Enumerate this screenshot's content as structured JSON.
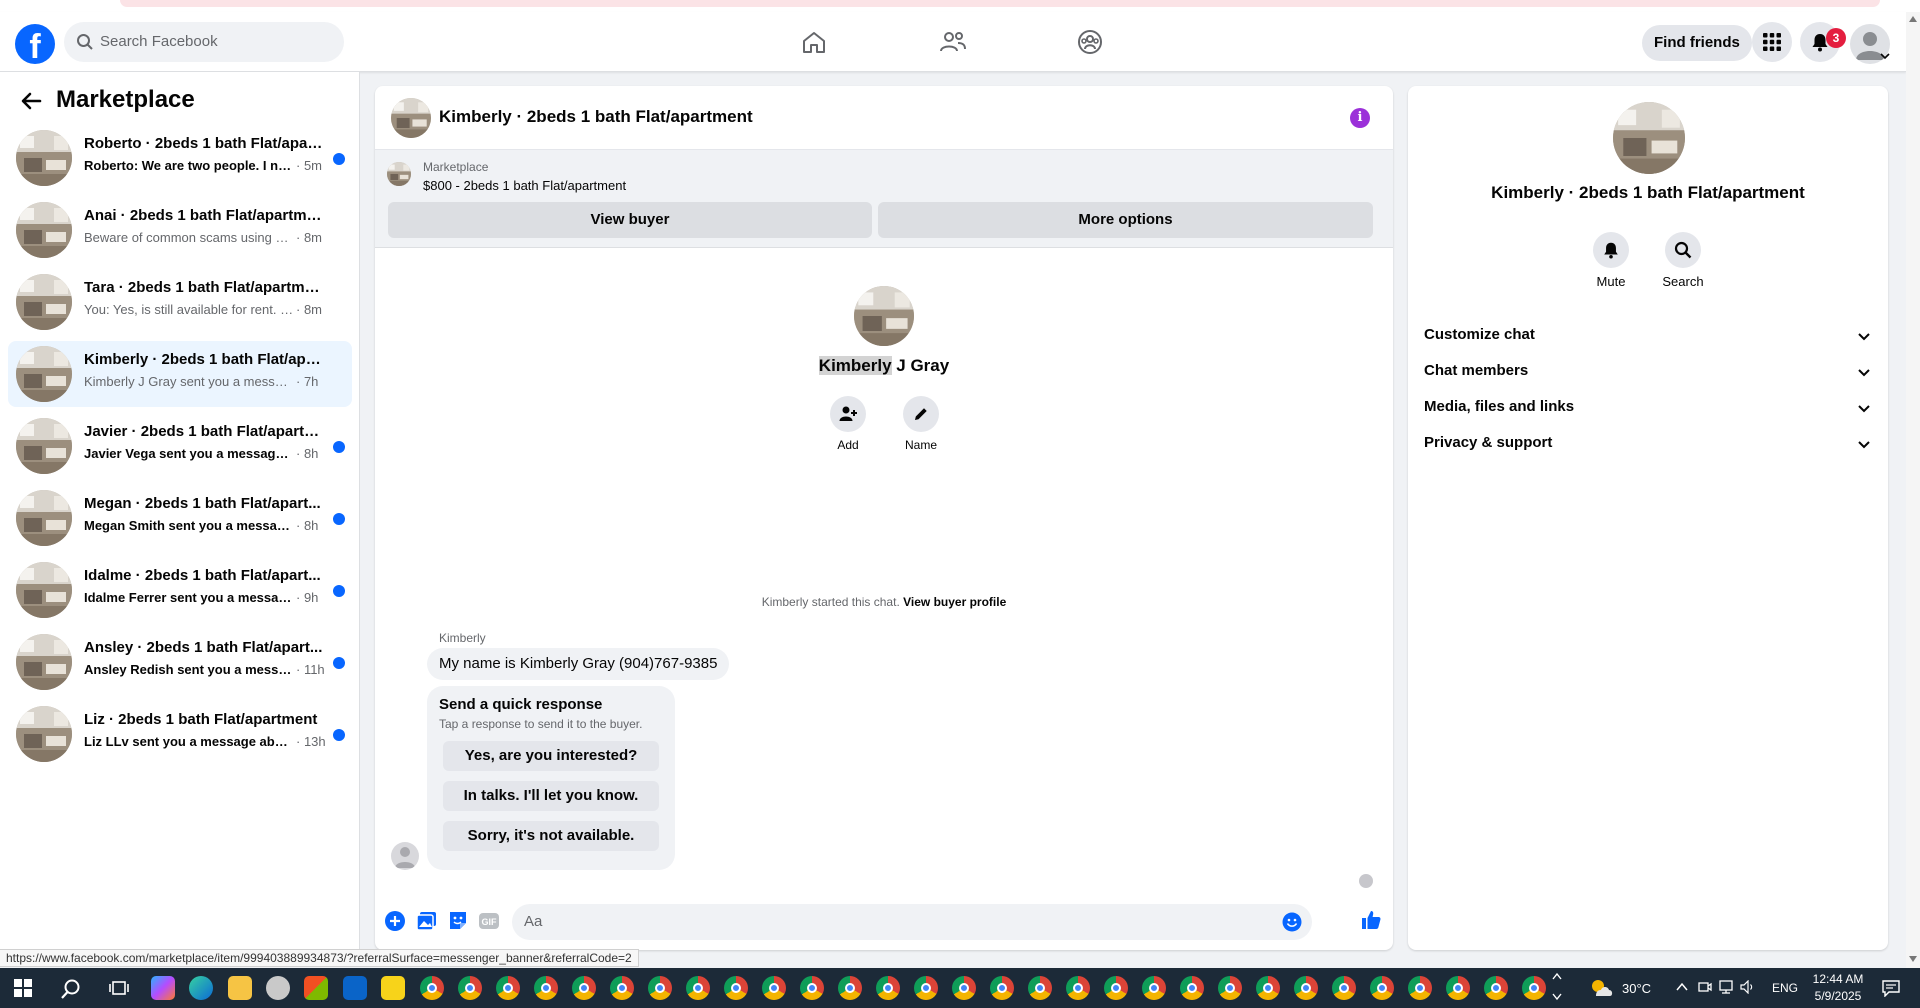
{
  "nav": {
    "search_placeholder": "Search Facebook",
    "find_friends": "Find friends",
    "notification_count": "3"
  },
  "sidebar": {
    "title": "Marketplace",
    "conversations": [
      {
        "name": "Roberto · 2beds 1 bath Flat/apar...",
        "preview": "Roberto: We are two people. I nee...",
        "time": "· 5m",
        "unread": true
      },
      {
        "name": "Anai · 2beds 1 bath Flat/apartment",
        "preview": "Beware of common scams using pay...",
        "time": "· 8m",
        "unread": false
      },
      {
        "name": "Tara · 2beds 1 bath Flat/apartment",
        "preview": "You: Yes, is still available for rent. Plea...",
        "time": "· 8m",
        "unread": false
      },
      {
        "name": "Kimberly · 2beds 1 bath Flat/apart...",
        "preview": "Kimberly J Gray sent you a message a...",
        "time": "· 7h",
        "unread": false
      },
      {
        "name": "Javier · 2beds 1 bath Flat/apartm...",
        "preview": "Javier Vega sent you a message ab...",
        "time": "· 8h",
        "unread": true
      },
      {
        "name": "Megan · 2beds 1 bath Flat/apart...",
        "preview": "Megan Smith sent you a message ...",
        "time": "· 8h",
        "unread": true
      },
      {
        "name": "Idalme · 2beds 1 bath Flat/apart...",
        "preview": "Idalme Ferrer sent you a message ...",
        "time": "· 9h",
        "unread": true
      },
      {
        "name": "Ansley · 2beds 1 bath Flat/apart...",
        "preview": "Ansley Redish sent you a messag...",
        "time": "· 11h",
        "unread": true
      },
      {
        "name": "Liz · 2beds 1 bath Flat/apartment",
        "preview": "Liz LLv sent you a message about...",
        "time": "· 13h",
        "unread": true
      }
    ]
  },
  "chat": {
    "title": "Kimberly · 2beds 1 bath Flat/apartment",
    "banner_label": "Marketplace",
    "banner_listing": "$800 - 2beds 1 bath Flat/apartment",
    "view_buyer": "View buyer",
    "more_options": "More options",
    "first_name": "Kimberly",
    "last_name_part": " J Gray",
    "add_label": "Add",
    "name_label": "Name",
    "started_text": "Kimberly started this chat.",
    "view_buyer_profile": "View buyer profile",
    "sender_name": "Kimberly",
    "message": "My name is Kimberly Gray (904)767-9385",
    "quick_title": "Send a quick response",
    "quick_subtitle": "Tap a response to send it to the buyer.",
    "quick_responses": [
      "Yes, are you interested?",
      "In talks. I'll let you know.",
      "Sorry, it's not available."
    ],
    "composer_placeholder": "Aa"
  },
  "status_url": "https://www.facebook.com/marketplace/item/999403889934873/?referralSurface=messenger_banner&referralCode=2",
  "details": {
    "name": "Kimberly · 2beds 1 bath Flat/apartment",
    "mute": "Mute",
    "search": "Search",
    "sections": [
      "Customize chat",
      "Chat members",
      "Media, files and links",
      "Privacy & support"
    ]
  },
  "taskbar": {
    "temperature": "30°C",
    "language": "ENG",
    "time": "12:44 AM",
    "date": "5/9/2025"
  },
  "colors": {
    "brand": "#0866ff",
    "unread_dot": "#0866ff",
    "badge": "#e41e3f",
    "info": "#9b30d9"
  }
}
